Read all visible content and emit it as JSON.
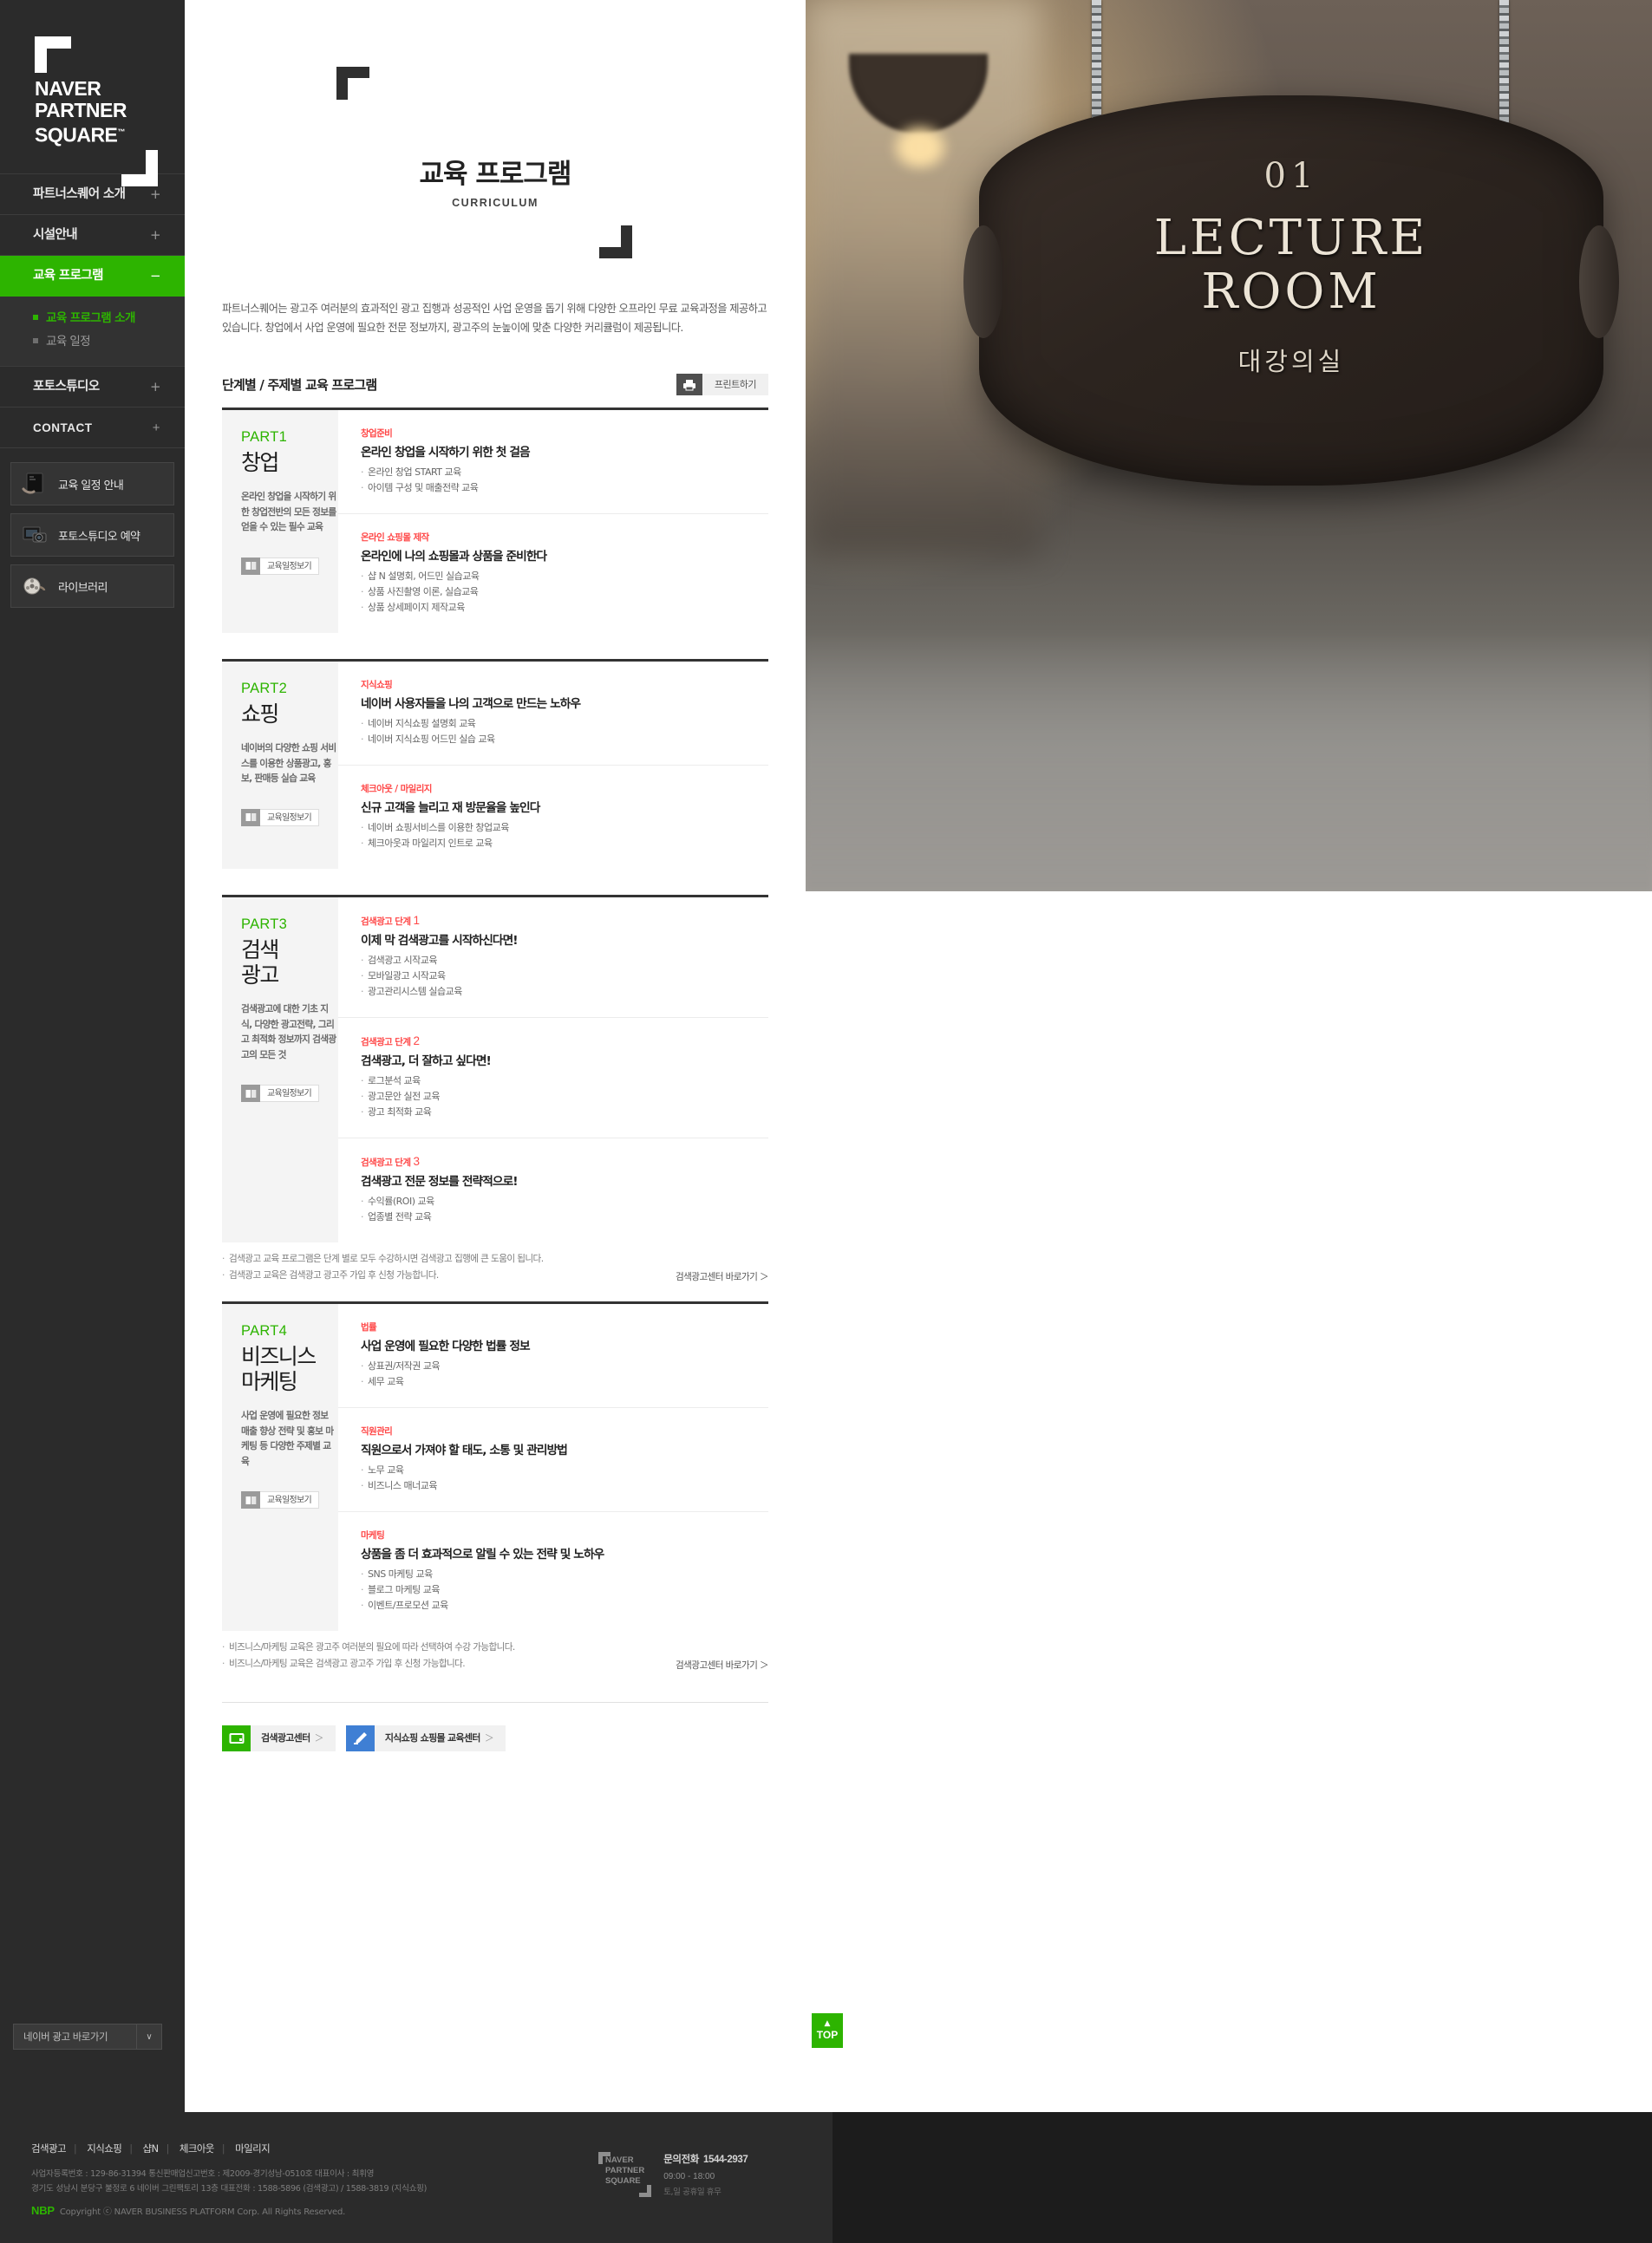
{
  "sidebar": {
    "logo": {
      "line1": "NAVER",
      "line2": "PARTNER",
      "line3": "SQUARE",
      "tm": "™"
    },
    "nav": [
      {
        "label": "파트너스퀘어 소개",
        "sign": "+"
      },
      {
        "label": "시설안내",
        "sign": "+"
      },
      {
        "label": "교육 프로그램",
        "sign": "−"
      },
      {
        "label": "포토스튜디오",
        "sign": "+"
      },
      {
        "label": "CONTACT",
        "sign": "+"
      }
    ],
    "submenu": [
      {
        "label": "교육 프로그램 소개"
      },
      {
        "label": "교육 일정"
      }
    ],
    "quicklinks": [
      {
        "label": "교육 일정 안내",
        "icon": "booklet-icon"
      },
      {
        "label": "포토스튜디오 예약",
        "icon": "camera-icon"
      },
      {
        "label": "라이브러리",
        "icon": "film-reel-icon"
      }
    ],
    "select": {
      "value": "네이버 광고 바로가기",
      "arrow": "∨"
    }
  },
  "header": {
    "title": "교육 프로그램",
    "subtitle": "CURRICULUM"
  },
  "intro": "파트너스퀘어는 광고주 여러분의 효과적인 광고 집행과 성공적인 사업 운영을 돕기 위해 다양한 오프라인 무료 교육과정을 제공하고 있습니다. 창업에서 사업 운영에 필요한 전문 정보까지, 광고주의 눈높이에 맞춘 다양한 커리큘럼이 제공됩니다.",
  "section": {
    "title": "단계별 / 주제별 교육 프로그램",
    "print_label": "프린트하기",
    "print_icon": "printer-icon"
  },
  "schedule_btn_label": "교육일정보기",
  "schedule_btn_icon": "book-icon",
  "parts": [
    {
      "num": "PART1",
      "name": "창업",
      "desc": "온라인 창업을 시작하기 위한 창업전반의 모든 정보를 얻을 수 있는 필수 교육",
      "topics": [
        {
          "tag": "창업준비",
          "step": "",
          "title": "온라인 창업을 시작하기 위한 첫 걸음",
          "items": [
            "온라인 창업 START 교육",
            "아이템 구성 및 매출전략 교육"
          ]
        },
        {
          "tag": "온라인 쇼핑몰 제작",
          "step": "",
          "title": "온라인에 나의 쇼핑몰과 상품을 준비한다",
          "items": [
            "샵 N 설명회, 어드민 실습교육",
            "상품 사진촬영 이론, 실습교육",
            "상품 상세페이지 제작교육"
          ]
        }
      ],
      "notes": [],
      "note_link": ""
    },
    {
      "num": "PART2",
      "name": "쇼핑",
      "desc": "네이버의 다양한 쇼핑 서비스를 이용한 상품광고, 홍보, 판매등 실습 교육",
      "topics": [
        {
          "tag": "지식쇼핑",
          "step": "",
          "title": "네이버 사용자들을 나의 고객으로 만드는 노하우",
          "items": [
            "네이버 지식쇼핑 설명회 교육",
            "네이버 지식쇼핑 어드민 실습 교육"
          ]
        },
        {
          "tag": "체크아웃 / 마일리지",
          "step": "",
          "title": "신규 고객을 늘리고 재 방문율을 높인다",
          "items": [
            "네이버 쇼핑서비스를 이용한 창업교육",
            "체크아웃과 마일리지 인트로 교육"
          ]
        }
      ],
      "notes": [],
      "note_link": ""
    },
    {
      "num": "PART3",
      "name": "검색\n광고",
      "desc": "검색광고에 대한 기초 지식, 다양한 광고전략, 그리고 최적화 정보까지 검색광고의 모든 것",
      "topics": [
        {
          "tag": "검색광고 단계",
          "step": "1",
          "title": "이제 막 검색광고를 시작하신다면!",
          "items": [
            "검색광고 시작교육",
            "모바일광고 시작교육",
            "광고관리시스템 실습교육"
          ]
        },
        {
          "tag": "검색광고 단계",
          "step": "2",
          "title": "검색광고, 더 잘하고 싶다면!",
          "items": [
            "로그분석 교육",
            "광고문안 실전 교육",
            "광고 최적화 교육"
          ]
        },
        {
          "tag": "검색광고 단계",
          "step": "3",
          "title": "검색광고 전문 정보를 전략적으로!",
          "items": [
            "수익률(ROI) 교육",
            "업종별 전략 교육"
          ]
        }
      ],
      "notes": [
        "검색광고 교육 프로그램은 단계 별로 모두 수강하시면 검색광고 집행에 큰 도움이 됩니다.",
        "검색광고 교육은 검색광고 광고주 가입 후 신청 가능합니다."
      ],
      "note_link": "검색광고센터 바로가기 ＞"
    },
    {
      "num": "PART4",
      "name": "비즈니스\n마케팅",
      "desc": "사업 운영에 필요한 정보 매출 향상 전략 및 홍보 마케팅 등 다양한 주제별 교육",
      "topics": [
        {
          "tag": "법률",
          "step": "",
          "title": "사업 운영에 필요한 다양한 법률 정보",
          "items": [
            "상표권/저작권 교육",
            "세무 교육"
          ]
        },
        {
          "tag": "직원관리",
          "step": "",
          "title": "직원으로서 가져야 할 태도, 소통 및 관리방법",
          "items": [
            "노무 교육",
            "비즈니스 매너교육"
          ]
        },
        {
          "tag": "마케팅",
          "step": "",
          "title": "상품을 좀 더 효과적으로 알릴 수 있는 전략 및 노하우",
          "items": [
            "SNS 마케팅 교육",
            "블로그 마케팅 교육",
            "이벤트/프로모션 교육"
          ]
        }
      ],
      "notes": [
        "비즈니스/마케팅 교육은 광고주 여러분의 필요에 따라 선택하여 수강 가능합니다.",
        "비즈니스/마케팅 교육은 검색광고 광고주 가입 후 신청 가능합니다."
      ],
      "note_link": "검색광고센터 바로가기 ＞"
    }
  ],
  "cta": [
    {
      "label": "검색광고센터",
      "arrow": "＞",
      "color": "#2db400",
      "icon": "monitor-icon"
    },
    {
      "label": "지식쇼핑 쇼핑몰 교육센터",
      "arrow": "＞",
      "color": "#3f7fd4",
      "icon": "pencil-icon"
    }
  ],
  "hero": {
    "sign_number": "01",
    "sign_en_line1": "LECTURE",
    "sign_en_line2": "ROOM",
    "sign_kr": "대강의실"
  },
  "top_button": {
    "label": "TOP",
    "arrow": "▲"
  },
  "footer": {
    "links": [
      "검색광고",
      "지식쇼핑",
      "샵N",
      "체크아웃",
      "마일리지"
    ],
    "info_line1": "사업자등록번호 : 129-86-31394   통신판매업신고번호 : 제2009-경기성남-0510호   대표이사 : 최휘영",
    "info_line2": "경기도 성남시 분당구 불정로 6 네이버 그린팩토리 13층   대표전화 : 1588-5896 (검색광고) / 1588-3819 (지식쇼핑)",
    "nbp": "NBP",
    "copyright": "Copyright ⓒ NAVER BUSINESS PLATFORM Corp. All Rights Reserved.",
    "logo": {
      "l1": "NAVER",
      "l2": "PARTNER",
      "l3": "SQUARE"
    },
    "tel_label": "문의전화",
    "tel_number": "1544-2937",
    "hours": "09:00 - 18:00",
    "closed": "토,일 공휴일 휴무"
  }
}
